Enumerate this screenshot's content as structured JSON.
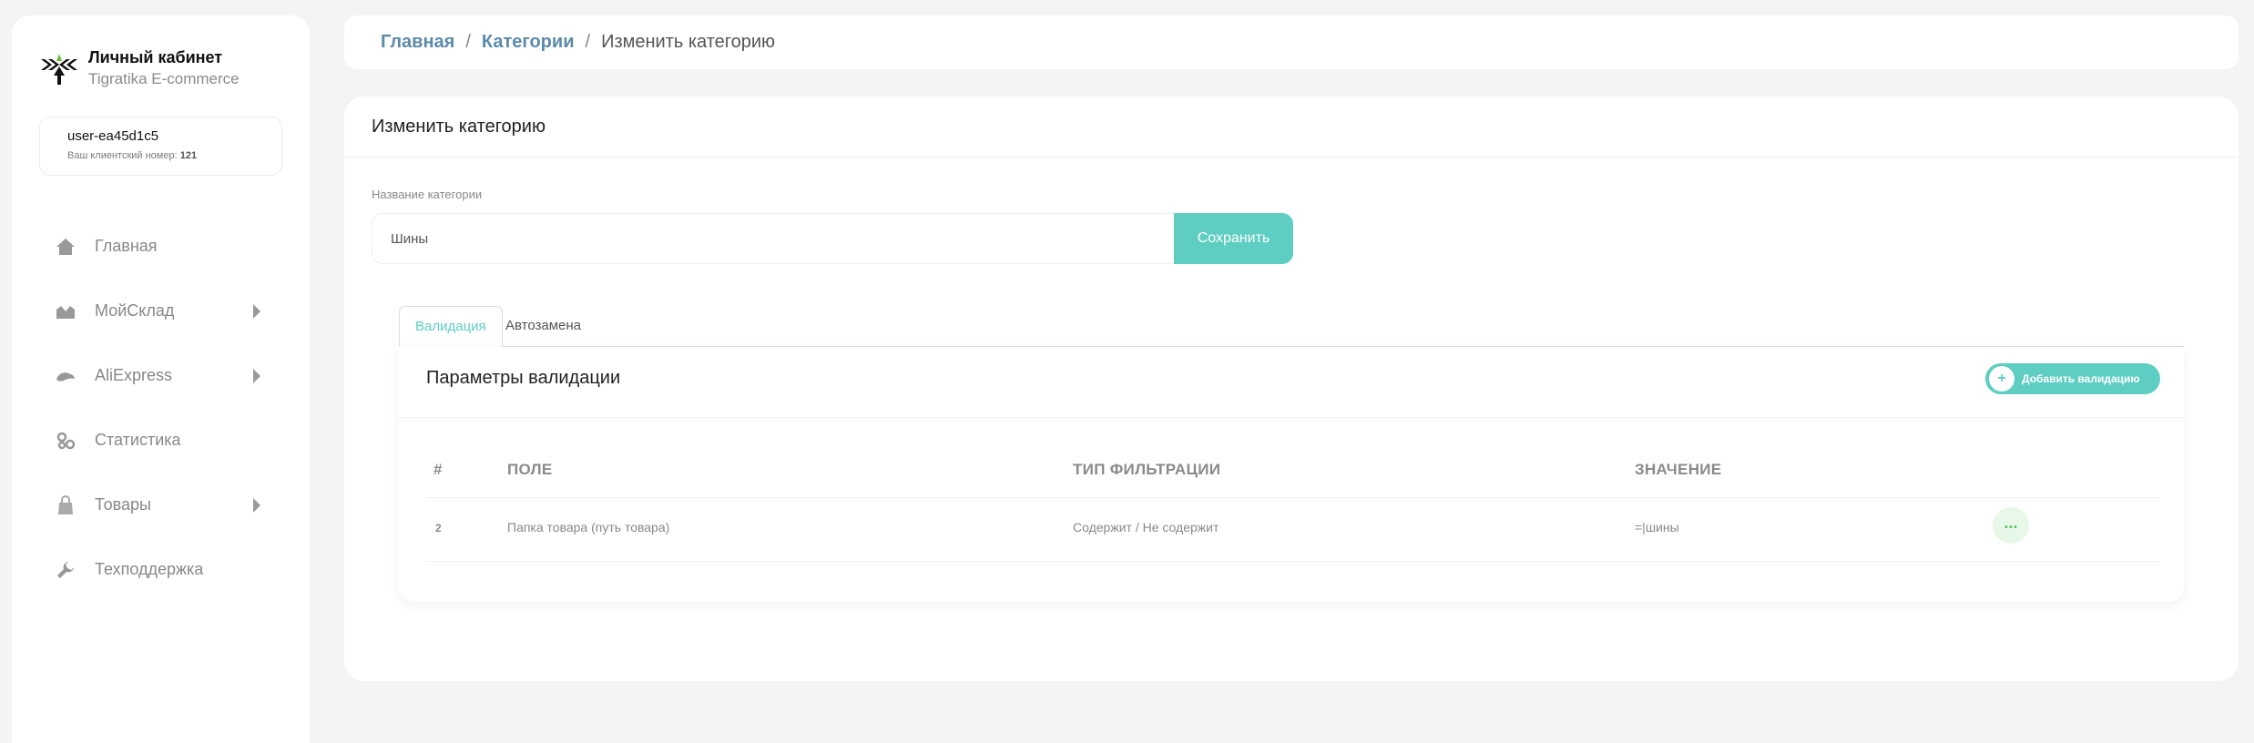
{
  "sidebar": {
    "brand": {
      "title": "Личный кабинет",
      "subtitle": "Tigratika E-commerce"
    },
    "user": {
      "name": "user-ea45d1c5",
      "client_label": "Ваш клиентский номер:",
      "client_number": "121"
    },
    "items": [
      {
        "label": "Главная",
        "icon": "home-icon",
        "has_arrow": false
      },
      {
        "label": "МойСклад",
        "icon": "warehouse-icon",
        "has_arrow": true
      },
      {
        "label": "AliExpress",
        "icon": "aliexpress-icon",
        "has_arrow": true
      },
      {
        "label": "Статистика",
        "icon": "statistics-icon",
        "has_arrow": false
      },
      {
        "label": "Товары",
        "icon": "bag-icon",
        "has_arrow": true
      },
      {
        "label": "Техподдержка",
        "icon": "wrench-icon",
        "has_arrow": false
      }
    ]
  },
  "breadcrumb": {
    "home": "Главная",
    "categories": "Категории",
    "current": "Изменить категорию",
    "separator": "/"
  },
  "main": {
    "title": "Изменить категорию",
    "field_label": "Название категории",
    "field_value": "Шины",
    "save_label": "Сохранить",
    "tabs": [
      {
        "label": "Валидация",
        "active": true
      },
      {
        "label": "Автозамена",
        "active": false
      }
    ],
    "validation": {
      "title": "Параметры валидации",
      "add_label": "Добавить валидацию",
      "add_icon": "+",
      "headers": {
        "num": "#",
        "field": "ПОЛЕ",
        "filter": "ТИП ФИЛЬТРАЦИИ",
        "value": "ЗНАЧЕНИЕ"
      },
      "rows": [
        {
          "num": "2",
          "field": "Папка товара (путь товара)",
          "filter": "Содержит / Не содержит",
          "value": "=|шины",
          "actions": "..."
        }
      ]
    }
  },
  "colors": {
    "accent": "#5ecec2",
    "link": "#5b8aa8",
    "background": "#f4f4f4"
  }
}
